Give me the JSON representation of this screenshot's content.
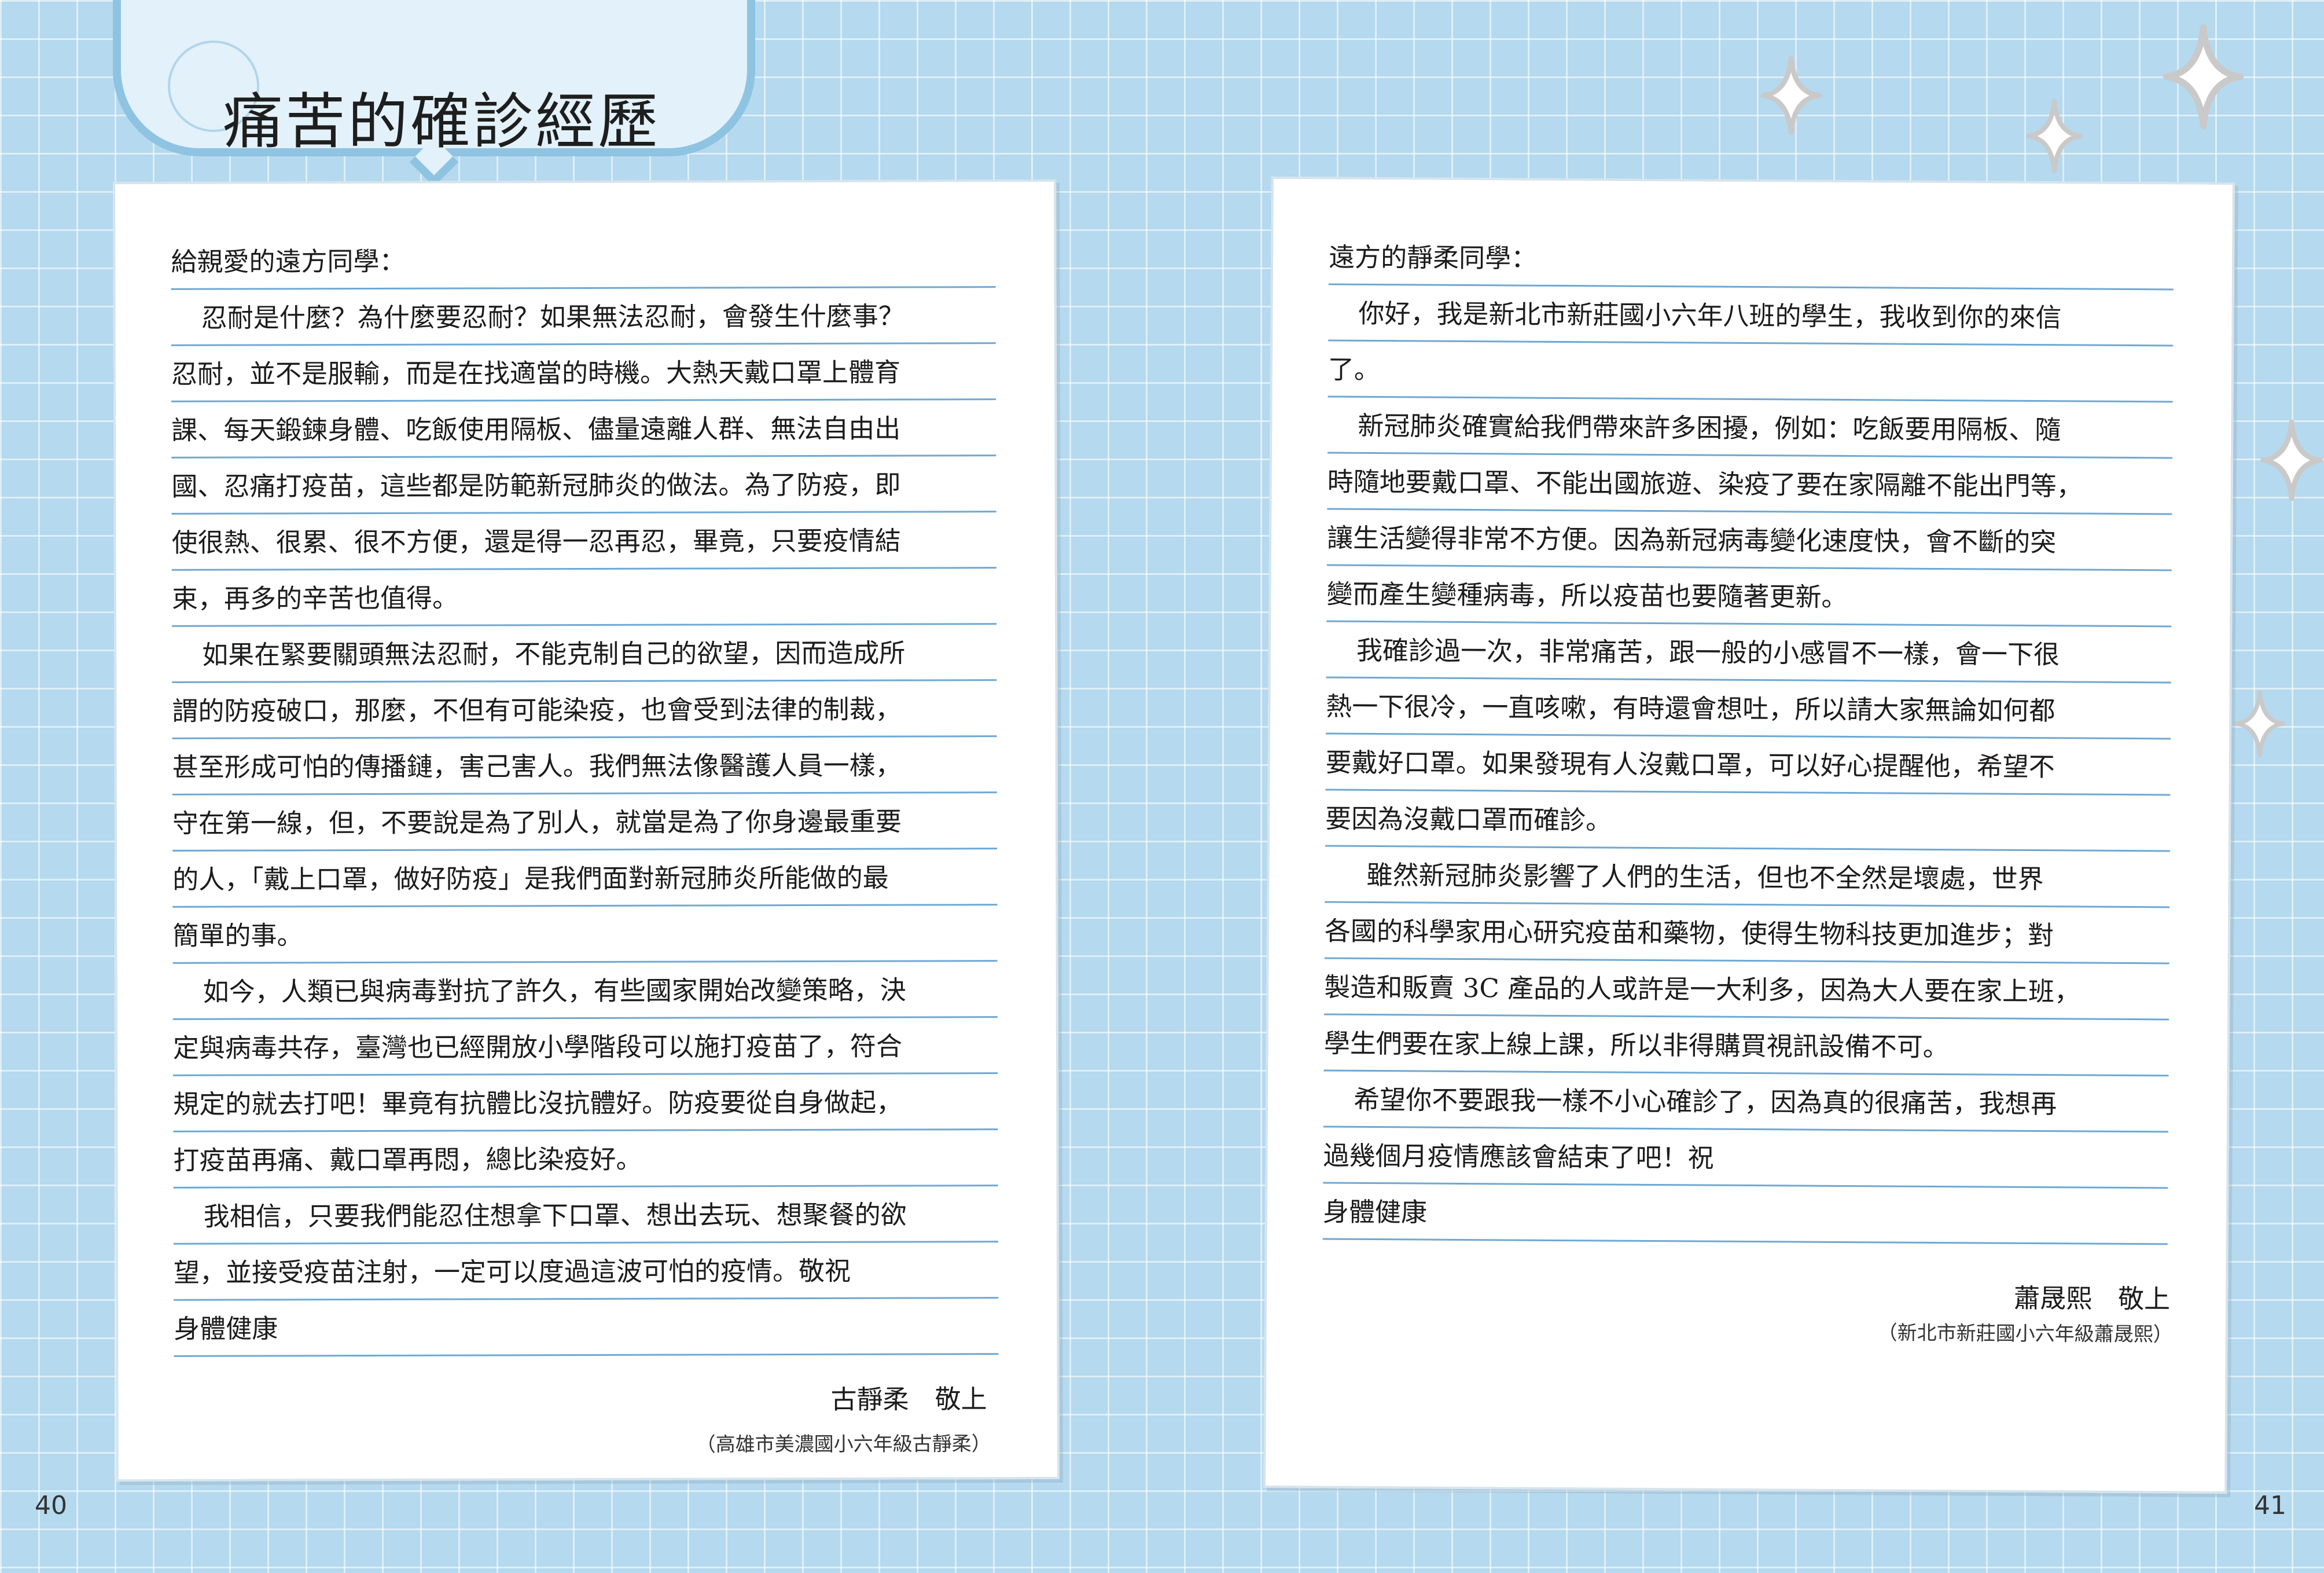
{
  "title": "痛苦的確診經歷",
  "left_letter": {
    "lines": [
      {
        "text": "給親愛的遠方同學：",
        "indent": false
      },
      {
        "text": "忍耐是什麼？為什麼要忍耐？如果無法忍耐，會發生什麼事？",
        "indent": true
      },
      {
        "text": "忍耐，並不是服輸，而是在找適當的時機。大熱天戴口罩上體育",
        "indent": false
      },
      {
        "text": "課、每天鍛鍊身體、吃飯使用隔板、儘量遠離人群、無法自由出",
        "indent": false
      },
      {
        "text": "國、忍痛打疫苗，這些都是防範新冠肺炎的做法。為了防疫，即",
        "indent": false
      },
      {
        "text": "使很熱、很累、很不方便，還是得一忍再忍，畢竟，只要疫情結",
        "indent": false
      },
      {
        "text": "束，再多的辛苦也值得。",
        "indent": false
      },
      {
        "text": "如果在緊要關頭無法忍耐，不能克制自己的欲望，因而造成所",
        "indent": true
      },
      {
        "text": "謂的防疫破口，那麼，不但有可能染疫，也會受到法律的制裁，",
        "indent": false
      },
      {
        "text": "甚至形成可怕的傳播鏈，害己害人。我們無法像醫護人員一樣，",
        "indent": false
      },
      {
        "text": "守在第一線，但，不要說是為了別人，就當是為了你身邊最重要",
        "indent": false
      },
      {
        "text": "的人，「戴上口罩，做好防疫」是我們面對新冠肺炎所能做的最",
        "indent": false
      },
      {
        "text": "簡單的事。",
        "indent": false
      },
      {
        "text": "如今，人類已與病毒對抗了許久，有些國家開始改變策略，決",
        "indent": true
      },
      {
        "text": "定與病毒共存，臺灣也已經開放小學階段可以施打疫苗了，符合",
        "indent": false
      },
      {
        "text": "規定的就去打吧！畢竟有抗體比沒抗體好。防疫要從自身做起，",
        "indent": false
      },
      {
        "text": "打疫苗再痛、戴口罩再悶，總比染疫好。",
        "indent": false
      },
      {
        "text": "我相信，只要我們能忍住想拿下口罩、想出去玩、想聚餐的欲",
        "indent": true
      },
      {
        "text": "望，並接受疫苗注射，一定可以度過這波可怕的疫情。敬祝",
        "indent": false
      },
      {
        "text": "身體健康",
        "indent": false
      }
    ],
    "signature": "古靜柔　敬上",
    "school": "（高雄市美濃國小六年級古靜柔）"
  },
  "right_letter": {
    "lines": [
      {
        "text": "遠方的靜柔同學：",
        "indent": false
      },
      {
        "text": "你好，我是新北市新莊國小六年八班的學生，我收到你的來信",
        "indent": true
      },
      {
        "text": "了。",
        "indent": false
      },
      {
        "text": "新冠肺炎確實給我們帶來許多困擾，例如：吃飯要用隔板、隨",
        "indent": true
      },
      {
        "text": "時隨地要戴口罩、不能出國旅遊、染疫了要在家隔離不能出門等，",
        "indent": false
      },
      {
        "text": "讓生活變得非常不方便。因為新冠病毒變化速度快，會不斷的突",
        "indent": false
      },
      {
        "text": "變而產生變種病毒，所以疫苗也要隨著更新。",
        "indent": false
      },
      {
        "text": "我確診過一次，非常痛苦，跟一般的小感冒不一樣，會一下很",
        "indent": true
      },
      {
        "text": "熱一下很冷，一直咳嗽，有時還會想吐，所以請大家無論如何都",
        "indent": false
      },
      {
        "text": "要戴好口罩。如果發現有人沒戴口罩，可以好心提醒他，希望不",
        "indent": false
      },
      {
        "text": "要因為沒戴口罩而確診。",
        "indent": false
      },
      {
        "text": "雖然新冠肺炎影響了人們的生活，但也不全然是壞處，世界",
        "indent": "wide"
      },
      {
        "text": "各國的科學家用心研究疫苗和藥物，使得生物科技更加進步；對",
        "indent": false
      },
      {
        "text": "製造和販賣 3C 產品的人或許是一大利多，因為大人要在家上班，",
        "indent": false
      },
      {
        "text": "學生們要在家上線上課，所以非得購買視訊設備不可。",
        "indent": false
      },
      {
        "text": "希望你不要跟我一樣不小心確診了，因為真的很痛苦，我想再",
        "indent": true
      },
      {
        "text": "過幾個月疫情應該會結束了吧！祝",
        "indent": false
      },
      {
        "text": "身體健康",
        "indent": false
      }
    ],
    "signature": "蕭晟熙　敬上",
    "school": "（新北市新莊國小六年級蕭晟熙）"
  },
  "page_numbers": {
    "left": "40",
    "right": "41"
  },
  "colors": {
    "background": "#b5d9ee",
    "accent": "#8fc3e2",
    "rule": "#6fa8d3",
    "sparkle": "#c9c9c9"
  },
  "icons": [
    "sparkle-icon"
  ]
}
